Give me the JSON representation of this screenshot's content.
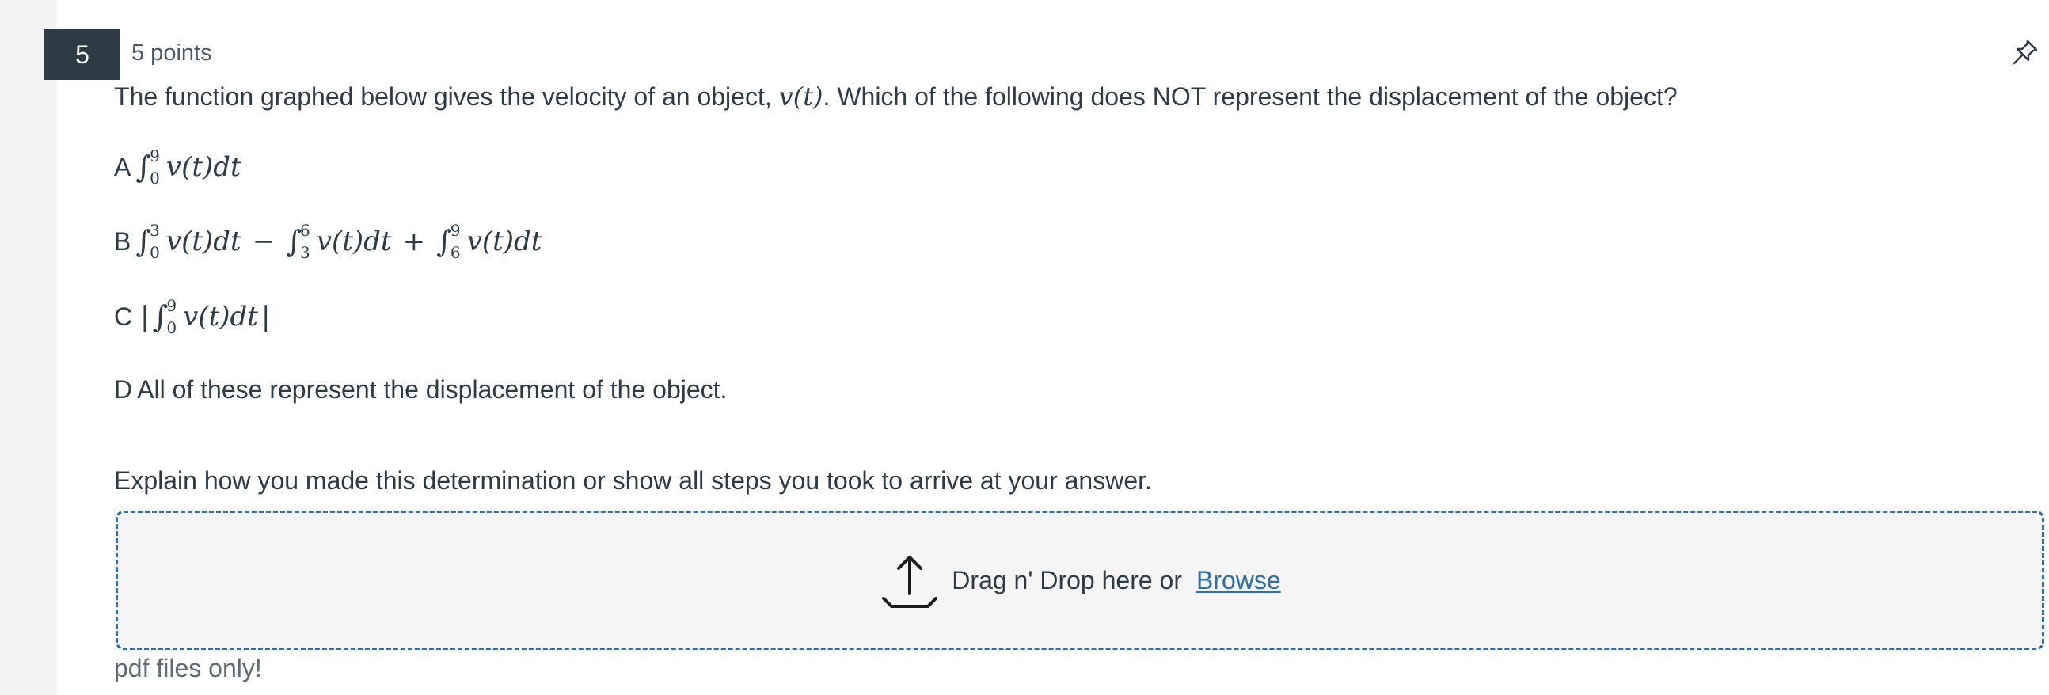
{
  "question": {
    "number": "5",
    "points": "5 points",
    "text_before": "The function graphed below gives the velocity of an object, ",
    "math_inline": "v(t)",
    "text_after": ". Which of the following does NOT represent the displacement of the object?"
  },
  "options": [
    {
      "letter": "A",
      "integrals": [
        {
          "upper": "9",
          "lower": "0",
          "integrand": "v(t)dt"
        }
      ]
    },
    {
      "letter": "B",
      "integrals": [
        {
          "upper": "3",
          "lower": "0",
          "integrand": "v(t)dt"
        },
        {
          "upper": "6",
          "lower": "3",
          "integrand": "v(t)dt"
        },
        {
          "upper": "9",
          "lower": "6",
          "integrand": "v(t)dt"
        }
      ],
      "operators": [
        "−",
        "+"
      ]
    },
    {
      "letter": "C",
      "bar": "|",
      "integrals": [
        {
          "upper": "9",
          "lower": "0",
          "integrand": "v(t)dt"
        }
      ]
    },
    {
      "letter": "D",
      "text": "All of these represent the displacement of the object."
    }
  ],
  "explain_prompt": "Explain how you made this determination or show all steps you took to arrive at your answer.",
  "upload": {
    "drop_text": "Drag n' Drop here or",
    "browse_label": "Browse",
    "note": "pdf files only!"
  },
  "icons": {
    "pin": "pin-icon",
    "upload": "upload-icon"
  },
  "colors": {
    "badge_bg": "#2d3b45",
    "link": "#2b6fb0",
    "dropzone_border": "#2b6fb0",
    "dropzone_bg": "#f5f5f5"
  }
}
